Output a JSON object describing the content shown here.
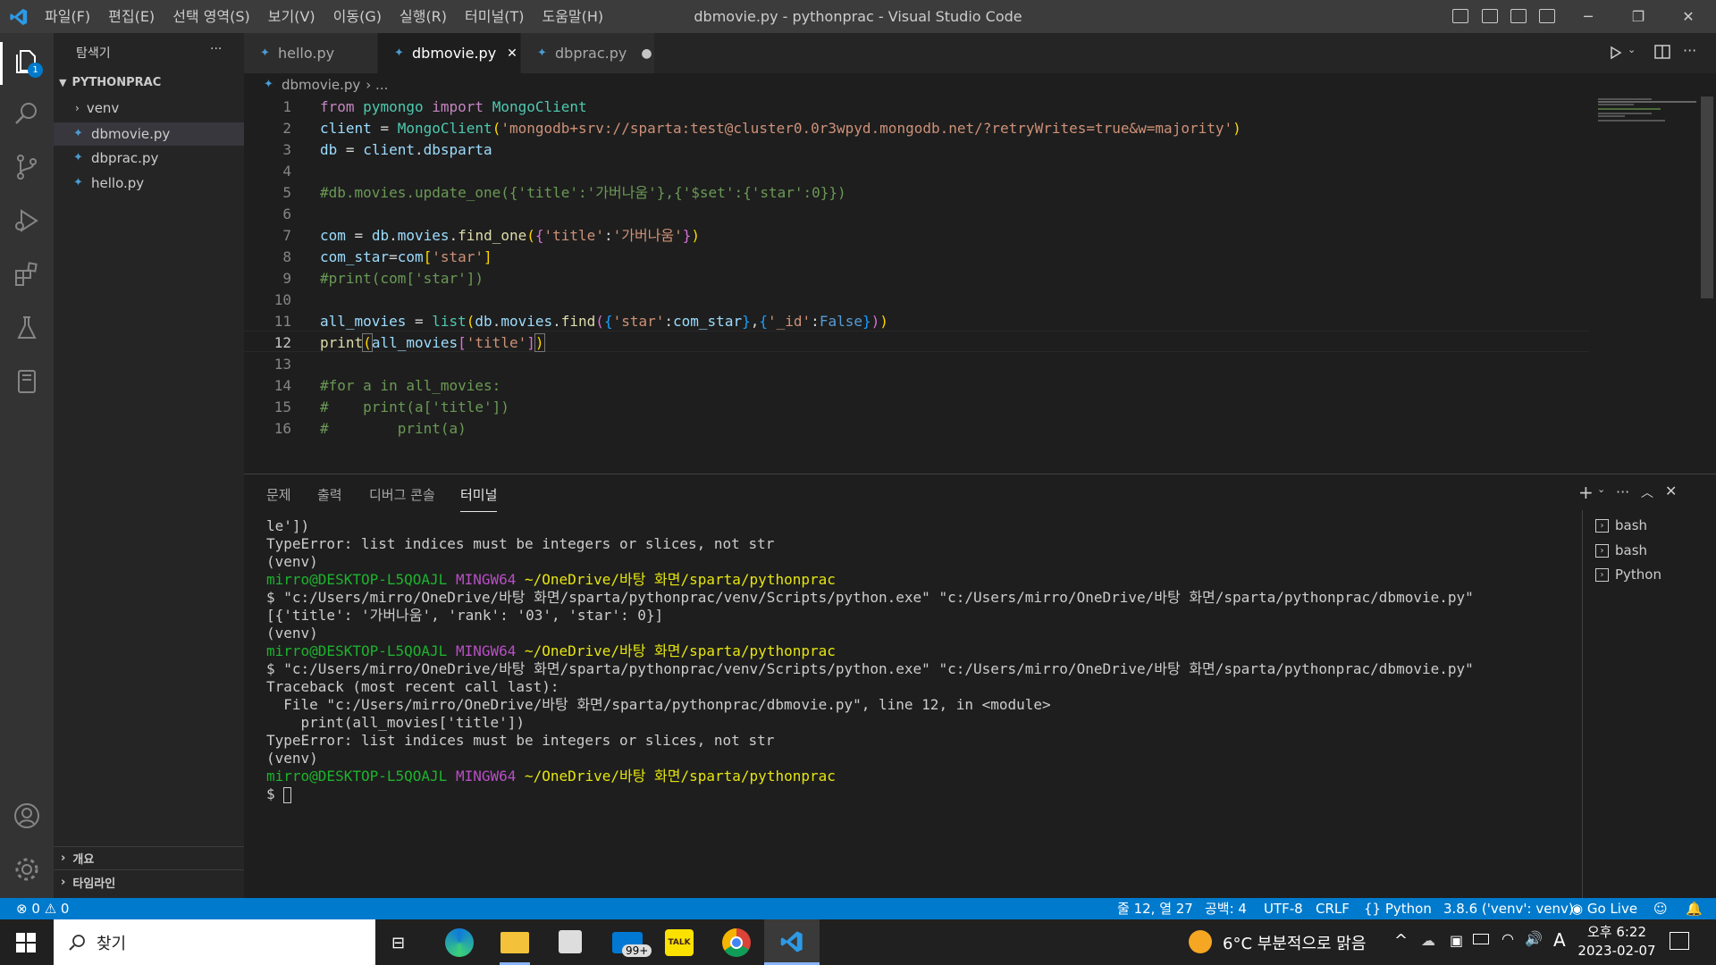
{
  "titlebar": {
    "menu": [
      "파일(F)",
      "편집(E)",
      "선택 영역(S)",
      "보기(V)",
      "이동(G)",
      "실행(R)",
      "터미널(T)",
      "도움말(H)"
    ],
    "title": "dbmovie.py - pythonprac - Visual Studio Code"
  },
  "activity": {
    "explorer_badge": "1"
  },
  "sidebar": {
    "header": "탐색기",
    "more": "···",
    "folder": "PYTHONPRAC",
    "items": [
      "venv",
      "dbmovie.py",
      "dbprac.py",
      "hello.py"
    ],
    "outline": "개요",
    "timeline": "타임라인"
  },
  "tabs": [
    {
      "label": "hello.py"
    },
    {
      "label": "dbmovie.py",
      "close": "✕"
    },
    {
      "label": "dbprac.py",
      "dirty": "●"
    }
  ],
  "breadcrumb": {
    "file": "dbmovie.py",
    "rest": "› ..."
  },
  "editor": {
    "current_line": 12,
    "line_numbers": [
      "1",
      "2",
      "3",
      "4",
      "5",
      "6",
      "7",
      "8",
      "9",
      "10",
      "11",
      "12",
      "13",
      "14",
      "15",
      "16"
    ]
  },
  "panel": {
    "tabs": [
      "문제",
      "출력",
      "디버그 콘솔",
      "터미널"
    ],
    "terminals": [
      "bash",
      "bash",
      "Python"
    ],
    "lines": {
      "l1": "le'])",
      "l2": "TypeError: list indices must be integers or slices, not str",
      "l3": "(venv)",
      "user": "mirro@DESKTOP-L5QOAJL",
      "mingw": "MINGW64",
      "path": "~/OneDrive/바탕 화면/sparta/pythonprac",
      "cmd": "$ \"c:/Users/mirro/OneDrive/바탕 화면/sparta/pythonprac/venv/Scripts/python.exe\" \"c:/Users/mirro/OneDrive/바탕 화면/sparta/pythonprac/dbmovie.py\"",
      "result": "[{'title': '가버나움', 'rank': '03', 'star': 0}]",
      "tb1": "Traceback (most recent call last):",
      "tb2": "  File \"c:/Users/mirro/OneDrive/바탕 화면/sparta/pythonprac/dbmovie.py\", line 12, in <module>",
      "tb3": "    print(all_movies['title'])",
      "prompt": "$ "
    }
  },
  "statusbar": {
    "errors": "0",
    "warnings": "0",
    "position": "줄 12, 열 27",
    "spaces": "공백: 4",
    "encoding": "UTF-8",
    "eol": "CRLF",
    "language": "Python",
    "interpreter": "3.8.6 ('venv': venv)",
    "golive": "Go Live"
  },
  "taskbar": {
    "search": "찾기",
    "mail_badge": "99+",
    "kakao": "TALK",
    "weather": "6°C  부분적으로 맑음",
    "ime": "A",
    "time": "오후 6:22",
    "date": "2023-02-07"
  },
  "colors": {
    "accent": "#007acc",
    "comment": "#6a9955",
    "string": "#ce9178"
  }
}
